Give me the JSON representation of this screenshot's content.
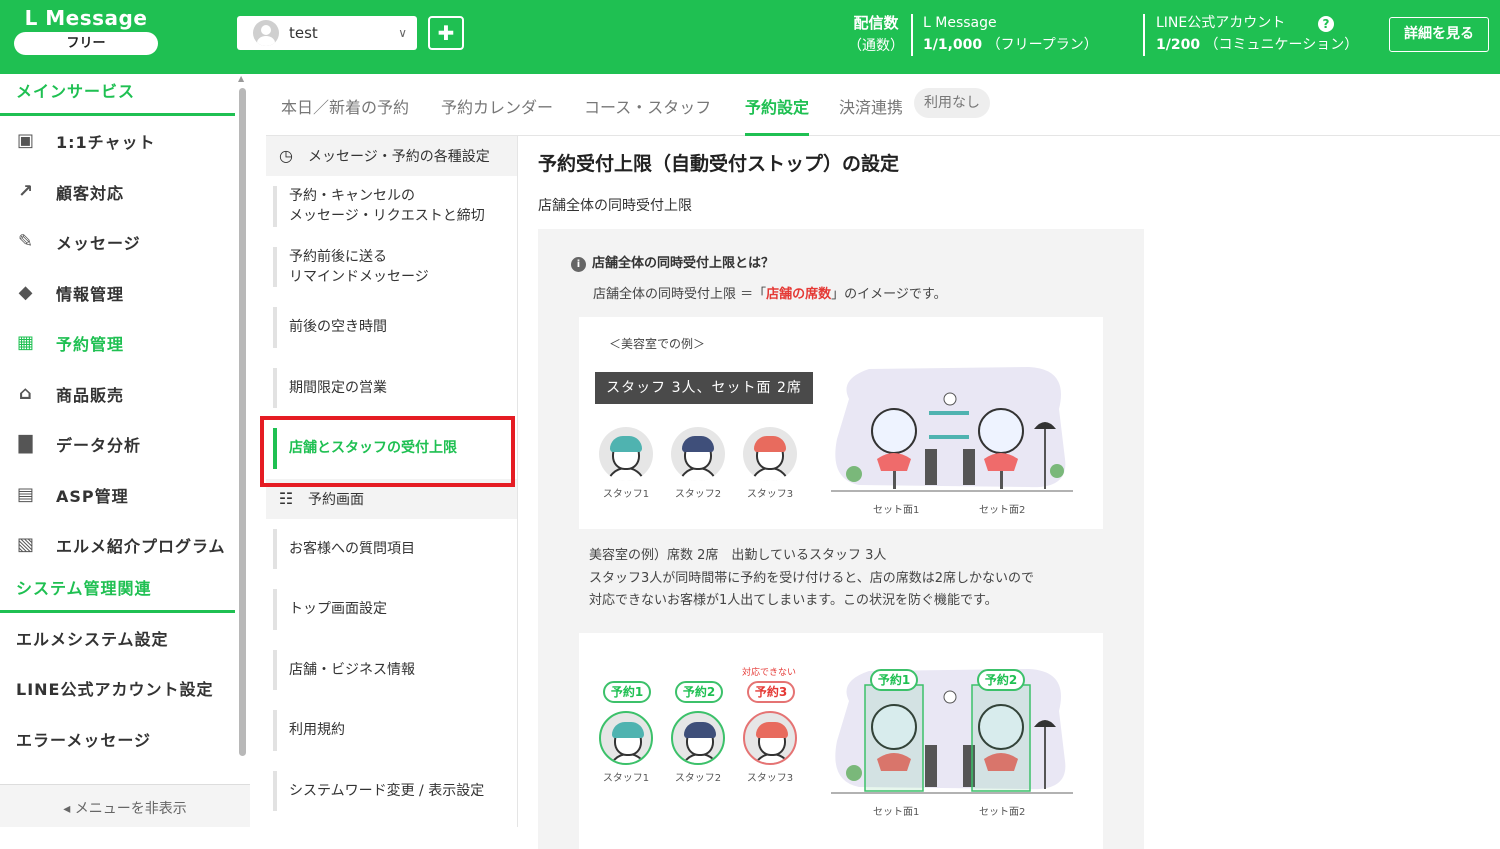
{
  "header": {
    "app_name": "L Message",
    "plan": "フリー",
    "account_name": "test",
    "stat1_label": "配信数",
    "stat1_sub": "（通数）",
    "stat2_label": "L Message",
    "stat2_value": "1/1,000",
    "stat2_note": "（フリープラン）",
    "stat3_label": "LINE公式アカウント",
    "stat3_value": "1/200",
    "stat3_note": "（コミュニケーション）",
    "detail_button": "詳細を見る",
    "brand_color": "#1fc052"
  },
  "sidebar": {
    "section_main": "メインサービス",
    "items": [
      {
        "label": "1:1チャット",
        "icon": "chat-icon"
      },
      {
        "label": "顧客対応",
        "icon": "arrow-box-icon"
      },
      {
        "label": "メッセージ",
        "icon": "edit-message-icon"
      },
      {
        "label": "情報管理",
        "icon": "tag-icon"
      },
      {
        "label": "予約管理",
        "icon": "calendar-icon",
        "active": true
      },
      {
        "label": "商品販売",
        "icon": "cart-icon"
      },
      {
        "label": "データ分析",
        "icon": "bar-chart-icon"
      },
      {
        "label": "ASP管理",
        "icon": "asp-icon"
      },
      {
        "label": "エルメ紹介プログラム",
        "icon": "clipboard-user-icon"
      }
    ],
    "section_system": "システム管理関連",
    "system_items": [
      "エルメシステム設定",
      "LINE公式アカウント設定",
      "エラーメッセージ"
    ],
    "hide_menu": "メニューを非表示"
  },
  "tabs": {
    "items": [
      "本日／新着の予約",
      "予約カレンダー",
      "コース・スタッフ",
      "予約設定",
      "決済連携"
    ],
    "active_index": 3,
    "badge": "利用なし"
  },
  "subnav": {
    "group1": "メッセージ・予約の各種設定",
    "group1_items": [
      [
        "予約・キャンセルの",
        "メッセージ・リクエストと締切"
      ],
      [
        "予約前後に送る",
        "リマインドメッセージ"
      ],
      [
        "前後の空き時間"
      ],
      [
        "期間限定の営業"
      ],
      [
        "店舗とスタッフの受付上限"
      ]
    ],
    "active_item": "店舗とスタッフの受付上限",
    "group2": "予約画面",
    "group2_items": [
      "お客様への質問項目",
      "トップ画面設定",
      "店舗・ビジネス情報",
      "利用規約",
      "システムワード変更 / 表示設定"
    ]
  },
  "main": {
    "title": "予約受付上限（自動受付ストップ）の設定",
    "subtitle": "店舗全体の同時受付上限",
    "info_heading": "店舗全体の同時受付上限とは？",
    "info_desc_pre": "店舗全体の同時受付上限 ＝「",
    "info_desc_red": "店舗の席数",
    "info_desc_post": "」のイメージです。",
    "example_label": "＜美容室での例＞",
    "banner": "スタッフ 3人、セット面 2席",
    "staff": [
      "スタッフ1",
      "スタッフ2",
      "スタッフ3"
    ],
    "seats": [
      "セット面1",
      "セット面2"
    ],
    "explain": [
      "美容室の例）席数 2席　出勤しているスタッフ 3人",
      "スタッフ3人が同時間帯に予約を受け付けると、店の席数は2席しかないので",
      "対応できないお客様が1人出てしまいます。この状況を防ぐ機能です。"
    ],
    "reservations": [
      "予約1",
      "予約2",
      "予約3"
    ],
    "cannot_handle": "対応できない",
    "seat_reservations": [
      "予約1",
      "予約2"
    ]
  }
}
